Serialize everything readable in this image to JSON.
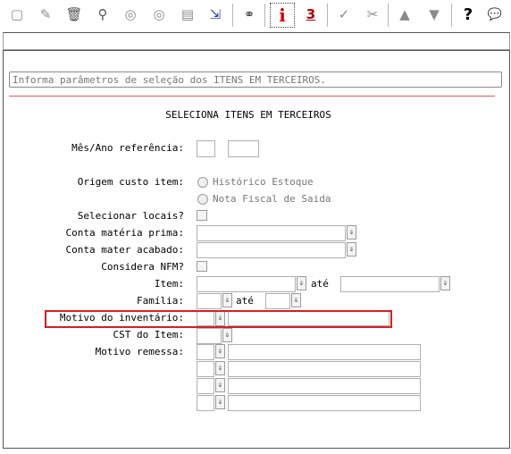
{
  "toolbar": {
    "buttons": [
      {
        "name": "new-record-icon",
        "glyph": "▢"
      },
      {
        "name": "edit-icon",
        "glyph": "✎"
      },
      {
        "name": "delete-icon",
        "glyph": "🗑"
      },
      {
        "name": "search-icon",
        "glyph": "⚲"
      },
      {
        "name": "previous-icon",
        "glyph": "◎"
      },
      {
        "name": "next-icon",
        "glyph": "◎"
      },
      {
        "name": "print-icon",
        "glyph": "▤"
      },
      {
        "name": "exit-icon",
        "glyph": "⇲"
      },
      {
        "name": "binoculars-icon",
        "glyph": "⚭"
      },
      {
        "name": "info-icon",
        "glyph": "i"
      },
      {
        "name": "number-icon",
        "glyph": "3"
      },
      {
        "name": "confirm-icon",
        "glyph": "✓"
      },
      {
        "name": "cancel-icon",
        "glyph": "✂"
      },
      {
        "name": "move-up-icon",
        "glyph": "▲"
      },
      {
        "name": "move-down-icon",
        "glyph": "▼"
      },
      {
        "name": "help-icon",
        "glyph": "?"
      },
      {
        "name": "chat-icon",
        "glyph": "💬"
      }
    ],
    "info_color": "#d00000"
  },
  "hint_text": "Informa parâmetros de seleção dos ITENS EM TERCEIROS.",
  "form": {
    "title": "SELECIONA ITENS EM TERCEIROS",
    "mes_ano_label": "Mês/Ano referência:",
    "origem_label": "Origem custo item:",
    "origem_options": [
      "Histórico Estoque",
      "Nota Fiscal de Saida"
    ],
    "selecionar_locais_label": "Selecionar locais?",
    "conta_materia_label": "Conta matéria prima:",
    "conta_mater_label": "Conta mater acabado:",
    "considera_nfm_label": "Considera NFM?",
    "item_label": "Item:",
    "familia_label": "Família:",
    "ate_label": "até",
    "motivo_inventario_label": "Motivo do inventário:",
    "cst_label": "CST do Item:",
    "motivo_remessa_label": "Motivo remessa:",
    "dropdown_glyph": "⇓"
  }
}
